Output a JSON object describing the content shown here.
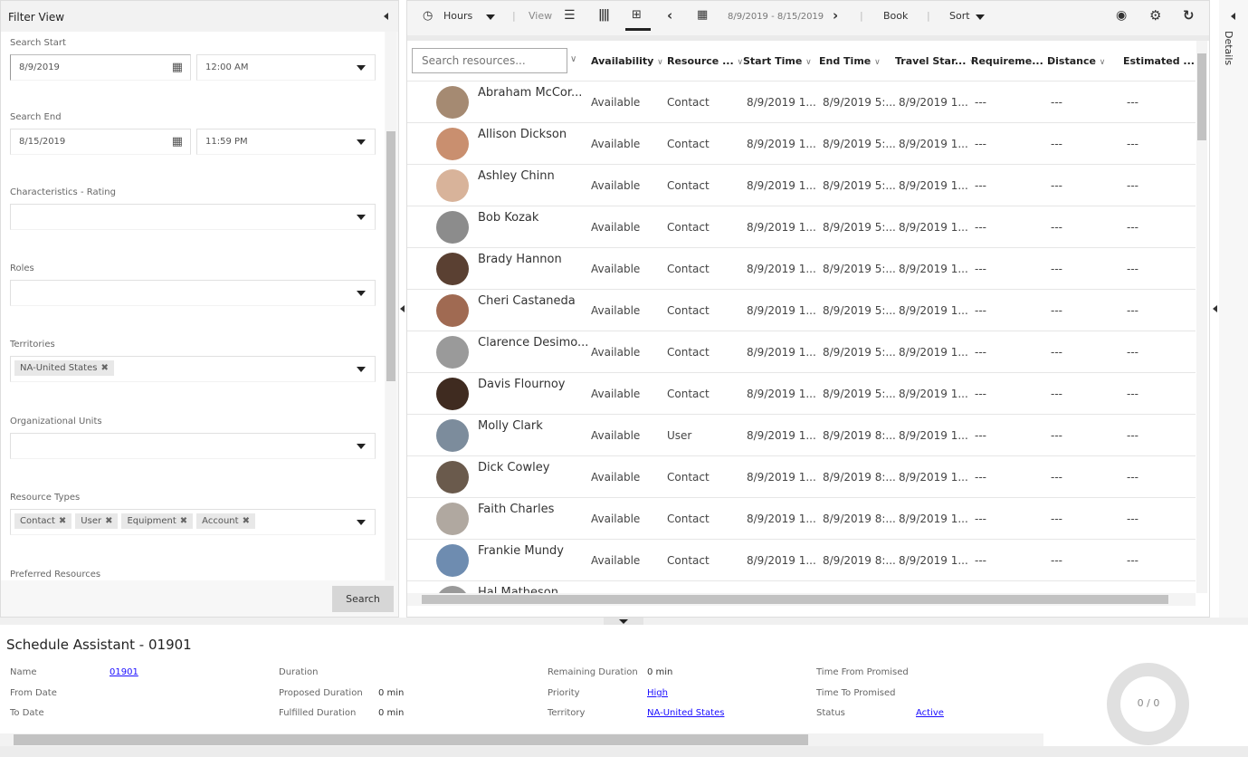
{
  "filter": {
    "title": "Filter View",
    "search_start_label": "Search Start",
    "search_start_date": "8/9/2019",
    "search_start_time": "12:00 AM",
    "search_end_label": "Search End",
    "search_end_date": "8/15/2019",
    "search_end_time": "11:59 PM",
    "rating_label": "Characteristics - Rating",
    "roles_label": "Roles",
    "territories_label": "Territories",
    "territories": [
      "NA-United States"
    ],
    "org_units_label": "Organizational Units",
    "resource_types_label": "Resource Types",
    "resource_types": [
      "Contact",
      "User",
      "Equipment",
      "Account"
    ],
    "preferred_label": "Preferred Resources",
    "search_button": "Search"
  },
  "toolbar": {
    "hours": "Hours",
    "view": "View",
    "date_range": "8/9/2019 - 8/15/2019",
    "book": "Book",
    "sort": "Sort"
  },
  "grid": {
    "search_placeholder": "Search resources...",
    "columns": [
      "Availability",
      "Resource ...",
      "Start Time",
      "End Time",
      "Travel Star...",
      "Requireme...",
      "Distance",
      "Estimated ..."
    ],
    "rows": [
      [
        "Abraham McCor...",
        "Available",
        "Contact",
        "8/9/2019 1...",
        "8/9/2019 5:...",
        "8/9/2019 1...",
        "---",
        "---",
        "---"
      ],
      [
        "Allison Dickson",
        "Available",
        "Contact",
        "8/9/2019 1...",
        "8/9/2019 5:...",
        "8/9/2019 1...",
        "---",
        "---",
        "---"
      ],
      [
        "Ashley Chinn",
        "Available",
        "Contact",
        "8/9/2019 1...",
        "8/9/2019 5:...",
        "8/9/2019 1...",
        "---",
        "---",
        "---"
      ],
      [
        "Bob Kozak",
        "Available",
        "Contact",
        "8/9/2019 1...",
        "8/9/2019 5:...",
        "8/9/2019 1...",
        "---",
        "---",
        "---"
      ],
      [
        "Brady Hannon",
        "Available",
        "Contact",
        "8/9/2019 1...",
        "8/9/2019 5:...",
        "8/9/2019 1...",
        "---",
        "---",
        "---"
      ],
      [
        "Cheri Castaneda",
        "Available",
        "Contact",
        "8/9/2019 1...",
        "8/9/2019 5:...",
        "8/9/2019 1...",
        "---",
        "---",
        "---"
      ],
      [
        "Clarence Desimo...",
        "Available",
        "Contact",
        "8/9/2019 1...",
        "8/9/2019 5:...",
        "8/9/2019 1...",
        "---",
        "---",
        "---"
      ],
      [
        "Davis Flournoy",
        "Available",
        "Contact",
        "8/9/2019 1...",
        "8/9/2019 5:...",
        "8/9/2019 1...",
        "---",
        "---",
        "---"
      ],
      [
        "Molly Clark",
        "Available",
        "User",
        "8/9/2019 1...",
        "8/9/2019 8:...",
        "8/9/2019 1...",
        "---",
        "---",
        "---"
      ],
      [
        "Dick Cowley",
        "Available",
        "Contact",
        "8/9/2019 1...",
        "8/9/2019 8:...",
        "8/9/2019 1...",
        "---",
        "---",
        "---"
      ],
      [
        "Faith Charles",
        "Available",
        "Contact",
        "8/9/2019 1...",
        "8/9/2019 8:...",
        "8/9/2019 1...",
        "---",
        "---",
        "---"
      ],
      [
        "Frankie Mundy",
        "Available",
        "Contact",
        "8/9/2019 1...",
        "8/9/2019 8:...",
        "8/9/2019 1...",
        "---",
        "---",
        "---"
      ],
      [
        "Hal Matheson",
        "",
        "",
        "",
        "",
        "",
        "",
        "",
        ""
      ]
    ]
  },
  "details": {
    "label": "Details"
  },
  "summary": {
    "title": "Schedule Assistant - 01901",
    "fields": [
      {
        "label": "Name",
        "value": "01901",
        "link": true
      },
      {
        "label": "From Date",
        "value": ""
      },
      {
        "label": "To Date",
        "value": ""
      },
      {
        "label": "Duration",
        "value": ""
      },
      {
        "label": "Proposed Duration",
        "value": "0 min"
      },
      {
        "label": "Fulfilled Duration",
        "value": "0 min"
      },
      {
        "label": "Remaining Duration",
        "value": "0 min"
      },
      {
        "label": "Priority",
        "value": "High",
        "link": true
      },
      {
        "label": "Territory",
        "value": "NA-United States",
        "link": true
      },
      {
        "label": "Time From Promised",
        "value": ""
      },
      {
        "label": "Time To Promised",
        "value": ""
      },
      {
        "label": "Status",
        "value": "Active",
        "link": true
      }
    ],
    "donut": "0 / 0"
  }
}
